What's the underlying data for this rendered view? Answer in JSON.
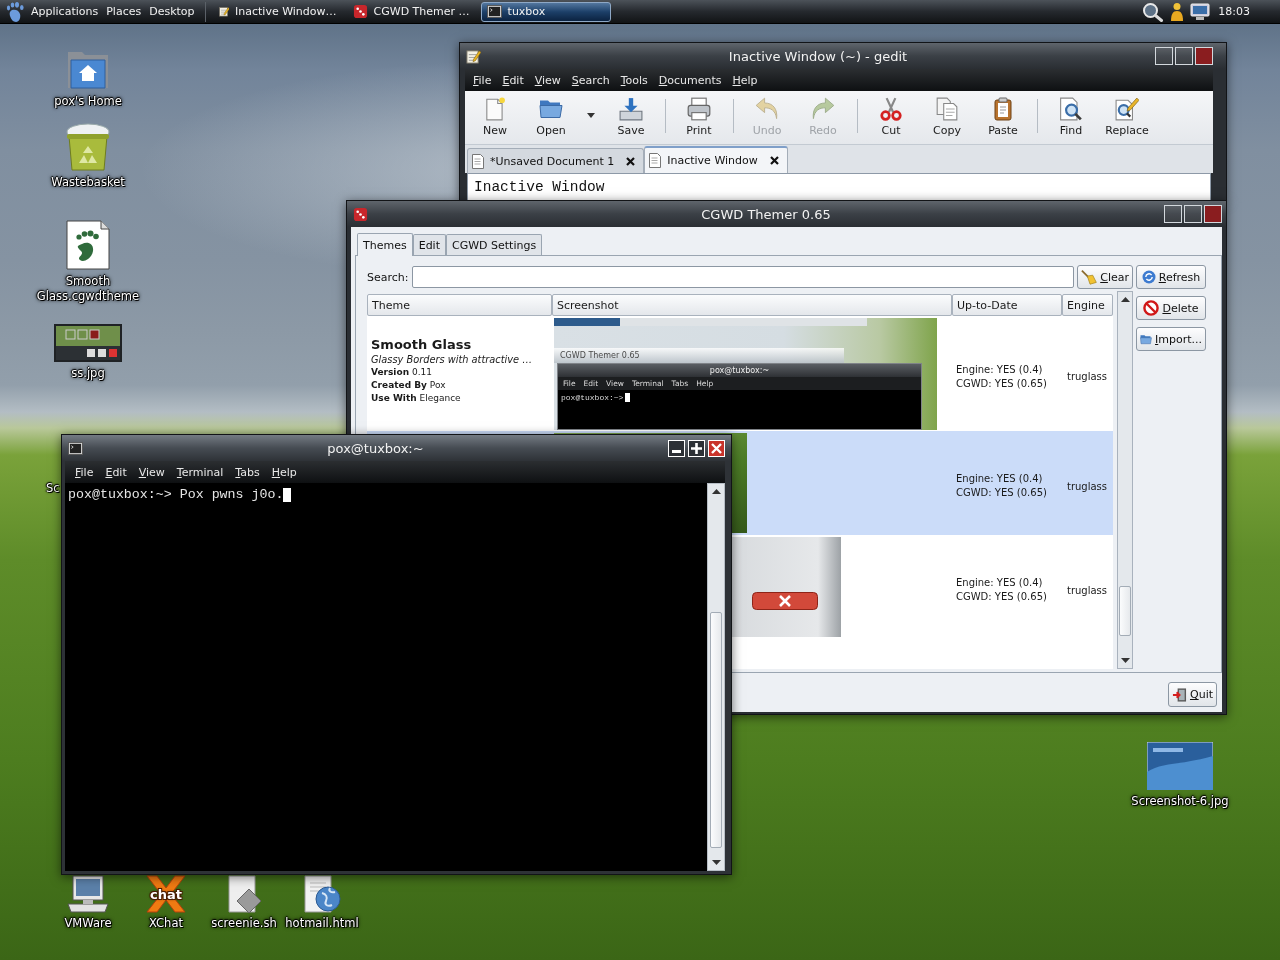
{
  "top_panel": {
    "menus": [
      "Applications",
      "Places",
      "Desktop"
    ],
    "tasks": [
      {
        "kind": "editor",
        "label": "Inactive Window…",
        "selected": false
      },
      {
        "kind": "themer",
        "label": "CGWD Themer …",
        "selected": false
      },
      {
        "kind": "terminal",
        "label": "tuxbox",
        "selected": true
      }
    ],
    "clock": "18:03"
  },
  "desktop_icons": {
    "left": [
      {
        "kind": "home",
        "label": "pox's Home"
      },
      {
        "kind": "trash",
        "label": "Wastebasket"
      },
      {
        "kind": "theme-file",
        "label": "Smooth Glass.cgwdtheme"
      },
      {
        "kind": "window-shot",
        "label": "ss.jpg"
      }
    ],
    "cut_off_label": "Sc",
    "bottom": [
      {
        "kind": "computer",
        "label": "VMWare"
      },
      {
        "kind": "xchat",
        "label": "XChat",
        "logo_text": "chat"
      },
      {
        "kind": "script",
        "label": "screenie.sh"
      },
      {
        "kind": "web-page",
        "label": "hotmail.html"
      }
    ],
    "right": [
      {
        "kind": "photo",
        "label": "Screenshot-6.jpg"
      }
    ]
  },
  "editor": {
    "active": false,
    "title": "Inactive Window (~) - gedit",
    "menu": [
      "File",
      "Edit",
      "View",
      "Search",
      "Tools",
      "Documents",
      "Help"
    ],
    "toolbar": [
      {
        "kind": "new",
        "label": "New",
        "disabled": false
      },
      {
        "kind": "open",
        "label": "Open",
        "disabled": false
      },
      {
        "kind": "dropdown"
      },
      {
        "kind": "save",
        "label": "Save",
        "disabled": false
      },
      {
        "kind": "separator"
      },
      {
        "kind": "print",
        "label": "Print",
        "disabled": false
      },
      {
        "kind": "separator"
      },
      {
        "kind": "undo",
        "label": "Undo",
        "disabled": true
      },
      {
        "kind": "redo",
        "label": "Redo",
        "disabled": true
      },
      {
        "kind": "separator"
      },
      {
        "kind": "cut",
        "label": "Cut",
        "disabled": false
      },
      {
        "kind": "copy",
        "label": "Copy",
        "disabled": false
      },
      {
        "kind": "paste",
        "label": "Paste",
        "disabled": false
      },
      {
        "kind": "separator"
      },
      {
        "kind": "find",
        "label": "Find",
        "disabled": false
      },
      {
        "kind": "replace",
        "label": "Replace",
        "disabled": false
      }
    ],
    "tabs": [
      {
        "label": "*Unsaved Document 1",
        "selected": false
      },
      {
        "label": "Inactive Window",
        "selected": true
      }
    ],
    "text": "Inactive Window"
  },
  "themer": {
    "active": false,
    "title": "CGWD Themer 0.65",
    "tabs": [
      {
        "label": "Themes",
        "selected": true
      },
      {
        "label": "Edit",
        "selected": false
      },
      {
        "label": "CGWD Settings",
        "selected": false
      }
    ],
    "search": {
      "label": "Search:"
    },
    "clear_button": "Clear",
    "side_buttons": [
      {
        "kind": "refresh",
        "label": "Refresh"
      },
      {
        "kind": "delete",
        "label": "Delete"
      },
      {
        "kind": "import",
        "label": "Import..."
      }
    ],
    "columns": [
      "Theme",
      "Screenshot",
      "Up-to-Date",
      "Engine"
    ],
    "rows": [
      {
        "selected": false,
        "name": "Smooth Glass",
        "description": "Glassy Borders with attractive …",
        "details": [
          "**Version** 0.11",
          "**Created By** Pox",
          "**Use With** Elegance"
        ],
        "preview": {
          "kind": "desktop",
          "window_title": "CGWD Themer 0.65",
          "terminal_title": "pox@tuxbox:~",
          "terminal_menu": [
            "File",
            "Edit",
            "View",
            "Terminal",
            "Tabs",
            "Help"
          ],
          "prompt": "pox@tuxbox:~>"
        },
        "status": [
          "Engine: YES (0.4)",
          "CGWD: YES (0.65)"
        ],
        "engine": "truglass"
      },
      {
        "selected": true,
        "preview": {
          "kind": "grass"
        },
        "status": [
          "Engine: YES (0.4)",
          "CGWD: YES (0.65)"
        ],
        "engine": "truglass"
      },
      {
        "selected": false,
        "preview": {
          "kind": "close-button"
        },
        "status": [
          "Engine: YES (0.4)",
          "CGWD: YES (0.65)"
        ],
        "engine": "truglass"
      }
    ],
    "quit_button": "Quit"
  },
  "terminal": {
    "active": true,
    "title": "pox@tuxbox:~",
    "menu": [
      "File",
      "Edit",
      "View",
      "Terminal",
      "Tabs",
      "Help"
    ],
    "lines": [
      "pox@tuxbox:~> Pox pwns j0o."
    ]
  }
}
